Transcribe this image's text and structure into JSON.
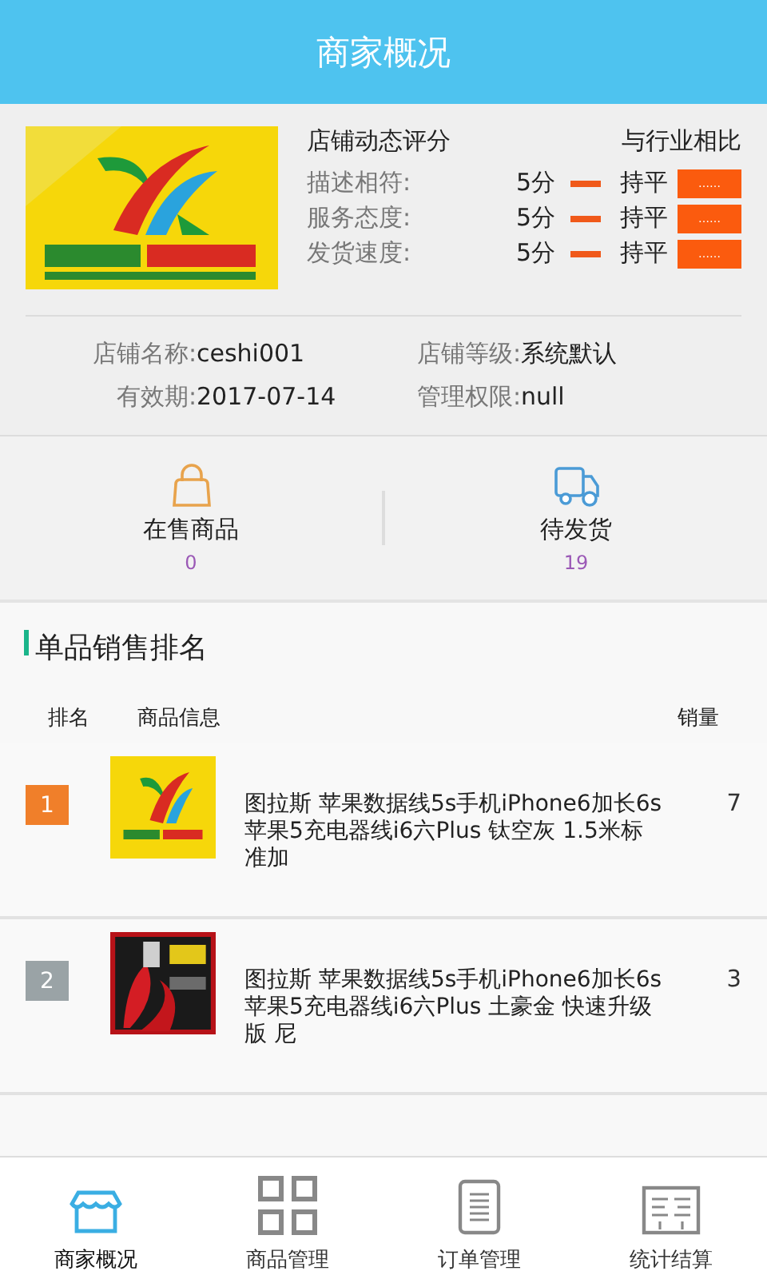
{
  "header": {
    "title": "商家概况"
  },
  "store": {
    "rating_title": "店铺动态评分",
    "compare_title": "与行业相比",
    "ratings": [
      {
        "label": "描述相符:",
        "score": "5分",
        "trend": "持平",
        "badge": "……"
      },
      {
        "label": "服务态度:",
        "score": "5分",
        "trend": "持平",
        "badge": "……"
      },
      {
        "label": "发货速度:",
        "score": "5分",
        "trend": "持平",
        "badge": "……"
      }
    ],
    "info": [
      {
        "label": "店铺名称:",
        "value": "ceshi001"
      },
      {
        "label": "店铺等级:",
        "value": "系统默认"
      },
      {
        "label": "有效期:",
        "value": "2017-07-14"
      },
      {
        "label": "管理权限:",
        "value": "null"
      }
    ]
  },
  "stats": [
    {
      "kind": "bag",
      "label": "在售商品",
      "count": "0"
    },
    {
      "kind": "truck",
      "label": "待发货",
      "count": "19"
    }
  ],
  "ranking": {
    "title": "单品销售排名",
    "columns": [
      "排名",
      "商品信息",
      "销量"
    ],
    "rows": [
      {
        "rank": "1",
        "color": "#f07f2a",
        "name": "图拉斯 苹果数据线5s手机iPhone6加长6s苹果5充电器线i6六Plus 钛空灰 1.5米标准加",
        "sales": "7"
      },
      {
        "rank": "2",
        "color": "#9aa3a6",
        "name": "图拉斯 苹果数据线5s手机iPhone6加长6s苹果5充电器线i6六Plus 土豪金 快速升级版 尼",
        "sales": "3"
      }
    ]
  },
  "tabs": [
    {
      "kind": "store",
      "label": "商家概况",
      "selected": true
    },
    {
      "kind": "grid",
      "label": "商品管理",
      "selected": false
    },
    {
      "kind": "list",
      "label": "订单管理",
      "selected": false
    },
    {
      "kind": "ledger",
      "label": "统计结算",
      "selected": false
    }
  ]
}
